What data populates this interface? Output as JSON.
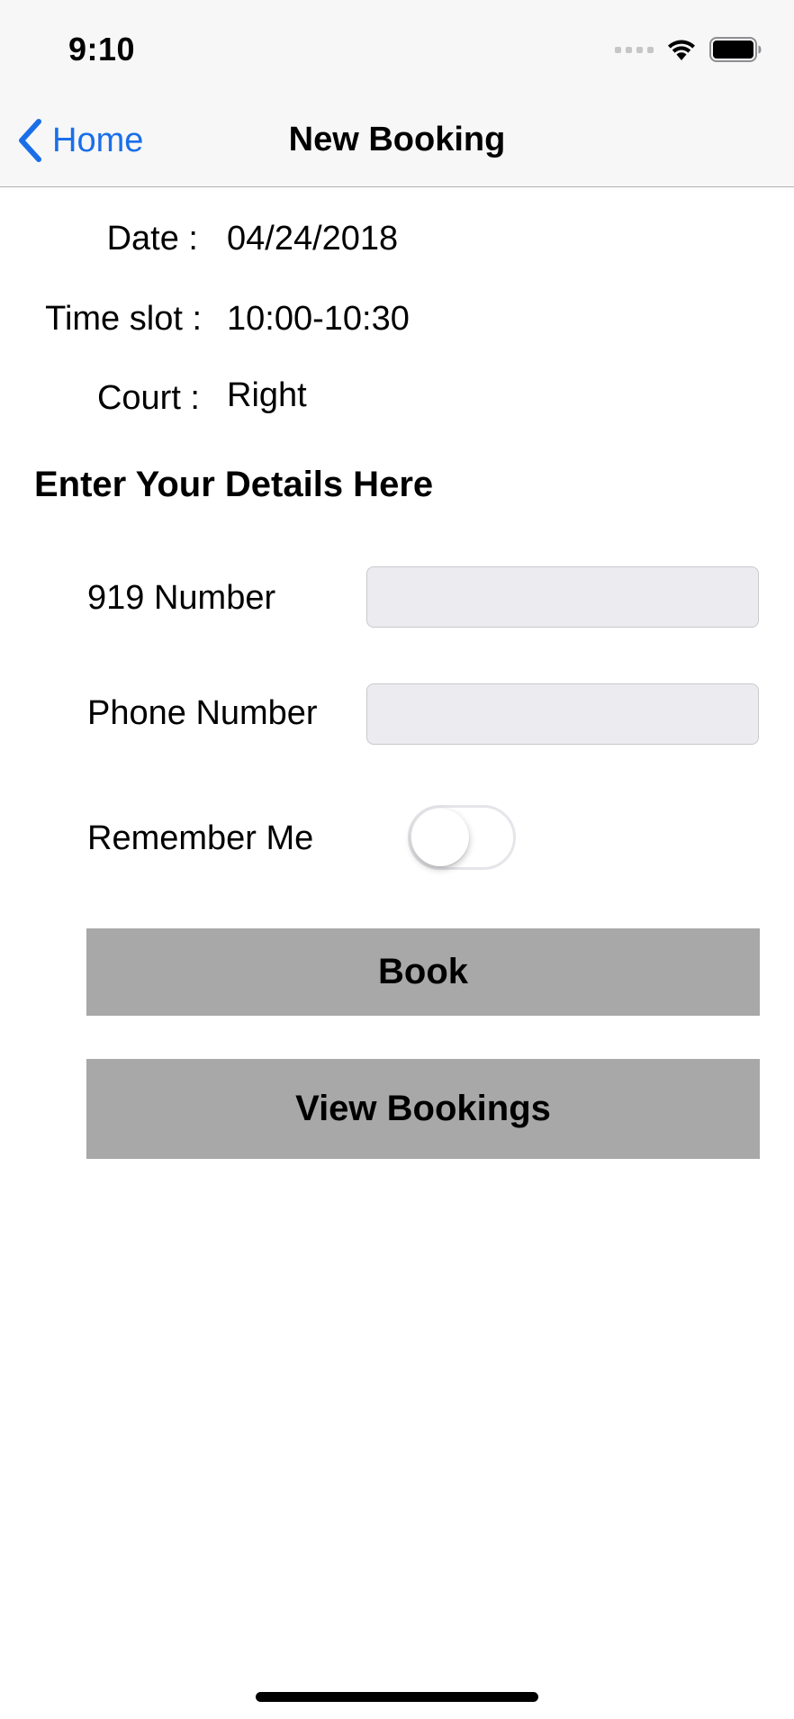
{
  "status_bar": {
    "time": "9:10"
  },
  "nav": {
    "back_label": "Home",
    "title": "New Booking"
  },
  "booking_info": {
    "date_label": "Date :",
    "date_value": "04/24/2018",
    "time_slot_label": "Time slot :",
    "time_slot_value": "10:00-10:30",
    "court_label": "Court :",
    "court_value": "Right"
  },
  "details": {
    "heading": "Enter Your Details Here",
    "number_919_label": "919 Number",
    "number_919_value": "",
    "phone_label": "Phone Number",
    "phone_value": "",
    "remember_label": "Remember Me",
    "remember_on": false
  },
  "buttons": {
    "book_label": "Book",
    "view_bookings_label": "View Bookings"
  },
  "colors": {
    "accent": "#1a6fe8",
    "button_bg": "#a8a8a8",
    "field_bg": "#ebebf0",
    "bar_bg": "#f7f7f7"
  },
  "icons": [
    "chevron-left-icon",
    "cellular-signal-icon",
    "wifi-icon",
    "battery-icon"
  ]
}
